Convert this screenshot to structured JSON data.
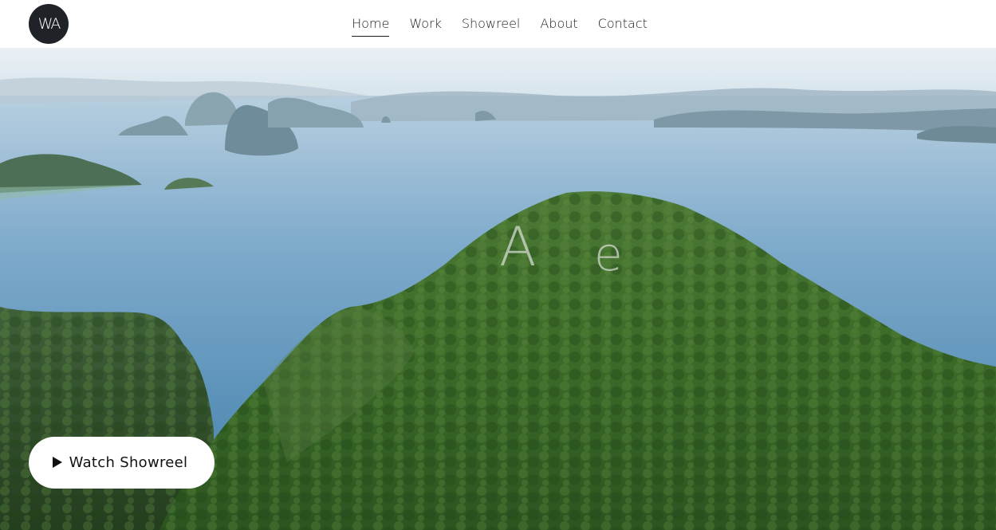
{
  "logo": {
    "text": "WA"
  },
  "nav": {
    "items": [
      {
        "label": "Home",
        "active": true
      },
      {
        "label": "Work",
        "active": false
      },
      {
        "label": "Showreel",
        "active": false
      },
      {
        "label": "About",
        "active": false
      },
      {
        "label": "Contact",
        "active": false
      }
    ]
  },
  "hero": {
    "title_letter_1": "A",
    "title_letter_2": "e",
    "watch_button_label": "Watch Showreel",
    "play_icon": "play-icon"
  },
  "colors": {
    "header_bg": "#ffffff",
    "logo_bg": "#1f2328",
    "nav_text": "#1d1d1d",
    "sea": "#5f95bc",
    "forest": "#3e6a2e"
  }
}
